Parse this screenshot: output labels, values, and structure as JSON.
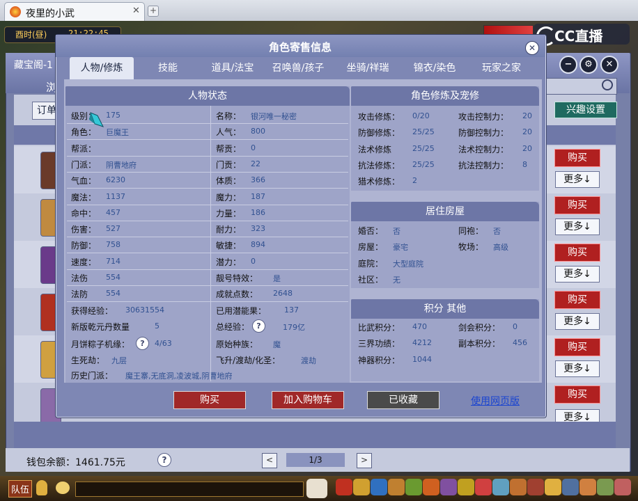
{
  "browser": {
    "tab_title": "夜里的小武",
    "tab_close": "✕",
    "new_tab": "+"
  },
  "game": {
    "time_label": "酉时(昼)",
    "clock": "21:22:45",
    "logo_text": "CC直播",
    "team_button": "队伍"
  },
  "background_window": {
    "title": "藏宝阁-1",
    "subtitle": "浏",
    "order_button": "订单",
    "interest_button": "兴趣设置",
    "buy_label": "购买",
    "more_label": "更多↓",
    "wallet": "钱包余额：1461.75元",
    "help": "?",
    "page": "1/3",
    "prev": "<",
    "next": ">",
    "controls": {
      "minimize": "−",
      "settings": "⚙",
      "close": "✕"
    }
  },
  "modal": {
    "title": "角色寄售信息",
    "close": "✕",
    "tabs": [
      "人物/修炼",
      "技能",
      "道具/法宝",
      "召唤兽/孩子",
      "坐骑/祥瑞",
      "锦衣/染色",
      "玩家之家"
    ],
    "active_tab": 0,
    "status": {
      "header": "人物状态",
      "left": [
        {
          "label": "级别：",
          "value": "175"
        },
        {
          "label": "角色：",
          "value": "巨魔王"
        },
        {
          "label": "帮派：",
          "value": ""
        },
        {
          "label": "门派：",
          "value": "阴曹地府"
        },
        {
          "label": "气血：",
          "value": "6230"
        },
        {
          "label": "魔法：",
          "value": "1137"
        },
        {
          "label": "命中：",
          "value": "457"
        },
        {
          "label": "伤害：",
          "value": "527"
        },
        {
          "label": "防御：",
          "value": "758"
        },
        {
          "label": "速度：",
          "value": "714"
        },
        {
          "label": "法伤",
          "value": "554"
        },
        {
          "label": "法防",
          "value": "554"
        }
      ],
      "right": [
        {
          "label": "名称：",
          "value": "银河唯一秘密"
        },
        {
          "label": "人气：",
          "value": "800"
        },
        {
          "label": "帮贡：",
          "value": "0"
        },
        {
          "label": "门贡：",
          "value": "22"
        },
        {
          "label": "体质：",
          "value": "366"
        },
        {
          "label": "魔力：",
          "value": "187"
        },
        {
          "label": "力量：",
          "value": "186"
        },
        {
          "label": "耐力：",
          "value": "323"
        },
        {
          "label": "敏捷：",
          "value": "894"
        },
        {
          "label": "潜力：",
          "value": "0"
        },
        {
          "label": "靓号特效：",
          "value": "是"
        },
        {
          "label": "成就点数：",
          "value": "2648"
        }
      ],
      "exp_label": "获得经验：",
      "exp_value": "30631554",
      "used_potential_label": "已用潜能果：",
      "used_potential_value": "137",
      "dan_label": "新版乾元丹数量",
      "dan_value": "5",
      "total_exp_label": "总经验：",
      "total_exp_value": "179亿",
      "mooncake_label": "月饼粽子机缘：",
      "mooncake_value": "4/63",
      "race_label": "原始种族：",
      "race_value": "魔",
      "life_label": "生死劫：",
      "life_value": "九层",
      "ascend_label": "飞升/渡劫/化圣：",
      "ascend_value": "渡劫",
      "history_label": "历史门派：",
      "history_value": "魔王寨,无底洞,凌波城,阴曹地府"
    },
    "cultivation": {
      "header": "角色修炼及宠修",
      "rows": [
        {
          "l1": "攻击修炼：",
          "v1": "0/20",
          "l2": "攻击控制力：",
          "v2": "20"
        },
        {
          "l1": "防御修炼：",
          "v1": "25/25",
          "l2": "防御控制力：",
          "v2": "20"
        },
        {
          "l1": "法术修炼",
          "v1": "25/25",
          "l2": "法术控制力：",
          "v2": "20"
        },
        {
          "l1": "抗法修炼：",
          "v1": "25/25",
          "l2": "抗法控制力：",
          "v2": "8"
        },
        {
          "l1": "猎术修炼：",
          "v1": "2",
          "l2": "",
          "v2": ""
        }
      ]
    },
    "housing": {
      "header": "居住房屋",
      "rows": [
        {
          "l1": "婚否：",
          "v1": "否",
          "l2": "同袍：",
          "v2": "否"
        },
        {
          "l1": "房屋：",
          "v1": "豪宅",
          "l2": "牧场：",
          "v2": "高级"
        },
        {
          "l1": "庭院：",
          "v1": "大型庭院",
          "l2": "",
          "v2": ""
        },
        {
          "l1": "社区：",
          "v1": "无",
          "l2": "",
          "v2": ""
        }
      ]
    },
    "points": {
      "header": "积分 其他",
      "rows": [
        {
          "l1": "比武积分：",
          "v1": "470",
          "l2": "剑会积分：",
          "v2": "0"
        },
        {
          "l1": "三界功绩：",
          "v1": "4212",
          "l2": "副本积分：",
          "v2": "456"
        },
        {
          "l1": "神器积分：",
          "v1": "1044",
          "l2": "",
          "v2": ""
        }
      ]
    },
    "buttons": {
      "buy": "购买",
      "add_cart": "加入购物车",
      "collected": "已收藏",
      "web": "使用网页版"
    }
  }
}
